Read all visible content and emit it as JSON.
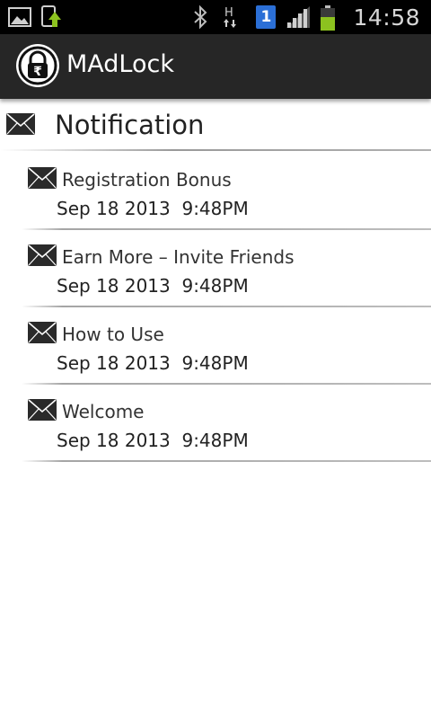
{
  "status_bar": {
    "time": "14:58",
    "sim_slot": "1",
    "network_type": "H",
    "icons": [
      "gallery-icon",
      "download-icon",
      "bluetooth-icon",
      "hspa-icon",
      "sim-icon",
      "signal-icon",
      "battery-icon"
    ]
  },
  "action_bar": {
    "title": "MAdLock",
    "logo_icon": "rupee-lock-icon",
    "background": "#262626"
  },
  "header": {
    "title": "Notification",
    "icon": "envelope-icon"
  },
  "notifications": [
    {
      "title": "Registration Bonus",
      "date": "Sep 18 2013  9:48PM"
    },
    {
      "title": "Earn More – Invite Friends",
      "date": "Sep 18 2013  9:48PM"
    },
    {
      "title": "How to Use",
      "date": "Sep 18 2013  9:48PM"
    },
    {
      "title": "Welcome",
      "date": "Sep 18 2013  9:48PM"
    }
  ],
  "colors": {
    "status_bar": "#000000",
    "action_bar": "#262626",
    "sim_badge": "#2b6fd6",
    "battery_fill": "#8cc21f"
  }
}
